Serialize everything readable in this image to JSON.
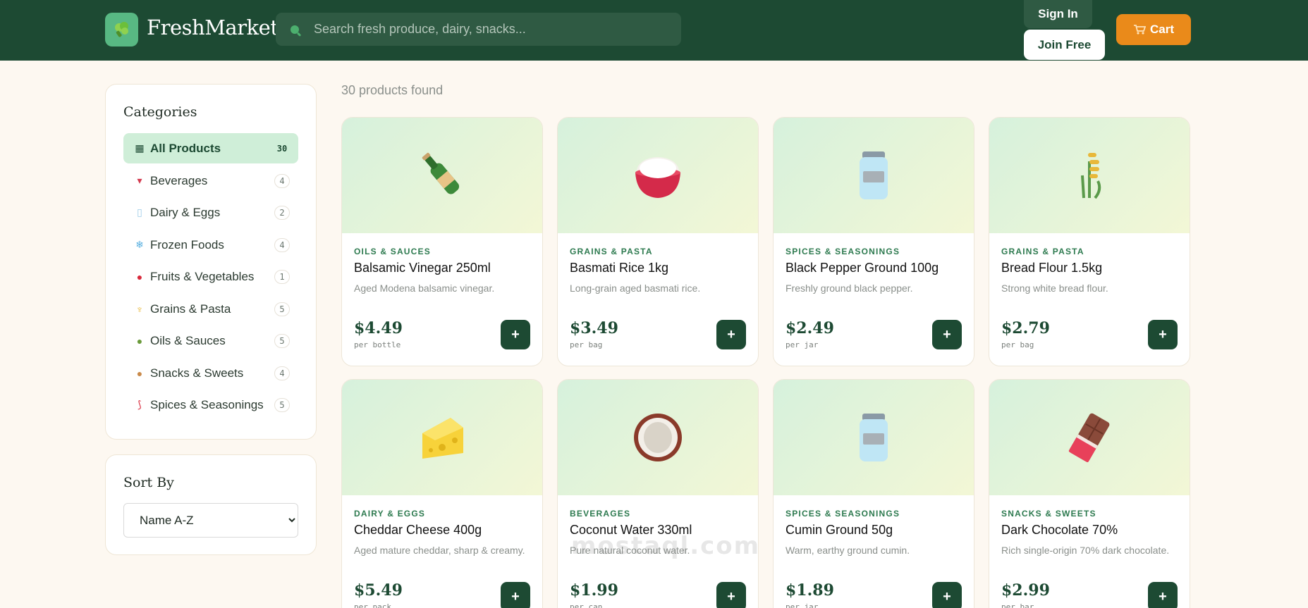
{
  "header": {
    "brand": "FreshMarket",
    "search_placeholder": "Search fresh produce, dairy, snacks...",
    "sign_in": "Sign In",
    "join_free": "Join Free",
    "cart": "Cart"
  },
  "sidebar": {
    "categories_title": "Categories",
    "categories": [
      {
        "label": "All Products",
        "count": "30",
        "icon": "store-icon"
      },
      {
        "label": "Beverages",
        "count": "4",
        "icon": "drink-icon"
      },
      {
        "label": "Dairy & Eggs",
        "count": "2",
        "icon": "milk-glass-icon"
      },
      {
        "label": "Frozen Foods",
        "count": "4",
        "icon": "snowflake-icon"
      },
      {
        "label": "Fruits & Vegetables",
        "count": "1",
        "icon": "apple-icon"
      },
      {
        "label": "Grains & Pasta",
        "count": "5",
        "icon": "wheat-icon"
      },
      {
        "label": "Oils & Sauces",
        "count": "5",
        "icon": "olive-icon"
      },
      {
        "label": "Snacks & Sweets",
        "count": "4",
        "icon": "cookie-icon"
      },
      {
        "label": "Spices & Seasonings",
        "count": "5",
        "icon": "chili-icon"
      }
    ],
    "sort_title": "Sort By",
    "sort_value": "Name A-Z"
  },
  "main": {
    "products_found": "30 products found",
    "products": [
      {
        "category": "OILS & SAUCES",
        "name": "Balsamic Vinegar 250ml",
        "description": "Aged Modena balsamic vinegar.",
        "price": "$4.49",
        "unit": "per bottle",
        "image": "bottle-icon"
      },
      {
        "category": "GRAINS & PASTA",
        "name": "Basmati Rice 1kg",
        "description": "Long-grain aged basmati rice.",
        "price": "$3.49",
        "unit": "per bag",
        "image": "rice-bowl-icon"
      },
      {
        "category": "SPICES & SEASONINGS",
        "name": "Black Pepper Ground 100g",
        "description": "Freshly ground black pepper.",
        "price": "$2.49",
        "unit": "per jar",
        "image": "jar-icon"
      },
      {
        "category": "GRAINS & PASTA",
        "name": "Bread Flour 1.5kg",
        "description": "Strong white bread flour.",
        "price": "$2.79",
        "unit": "per bag",
        "image": "wheat-icon"
      },
      {
        "category": "DAIRY & EGGS",
        "name": "Cheddar Cheese 400g",
        "description": "Aged mature cheddar, sharp & creamy.",
        "price": "$5.49",
        "unit": "per pack",
        "image": "cheese-icon"
      },
      {
        "category": "BEVERAGES",
        "name": "Coconut Water 330ml",
        "description": "Pure natural coconut water.",
        "price": "$1.99",
        "unit": "per can",
        "image": "coconut-icon"
      },
      {
        "category": "SPICES & SEASONINGS",
        "name": "Cumin Ground 50g",
        "description": "Warm, earthy ground cumin.",
        "price": "$1.89",
        "unit": "per jar",
        "image": "jar-icon"
      },
      {
        "category": "SNACKS & SWEETS",
        "name": "Dark Chocolate 70%",
        "description": "Rich single-origin 70% dark chocolate.",
        "price": "$2.99",
        "unit": "per bar",
        "image": "chocolate-bar-icon"
      }
    ],
    "watermark": "mostaql.com"
  },
  "colors": {
    "header_bg": "#1d4a33",
    "accent_cart": "#ea8a1a",
    "active_category_bg": "#cfeed8",
    "category_label": "#2d7a4f"
  }
}
